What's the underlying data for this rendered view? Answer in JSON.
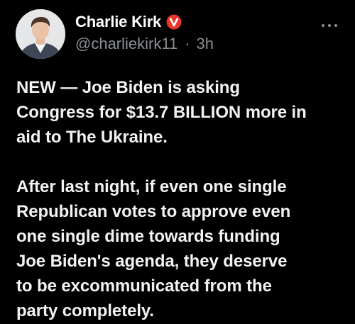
{
  "tweet": {
    "author": {
      "display_name": "Charlie Kirk",
      "handle": "@charliekirk11",
      "separator": "·",
      "time": "3h",
      "avatar": "avatar-photo",
      "verified_icon": "verified-badge-icon"
    },
    "more_icon": "more-horizontal-icon",
    "text": {
      "paragraph1": "NEW — Joe Biden is asking\nCongress for $13.7 BILLION more in\naid to The Ukraine.",
      "paragraph2": "After last night, if even one single\nRepublican votes to approve even\none single dime towards funding\nJoe Biden's agenda, they deserve\nto be excommunicated from the\nparty completely."
    }
  },
  "colors": {
    "background": "#000000",
    "text": "#f2f2f2",
    "muted": "#8b8f94",
    "badge": "#e8352c"
  }
}
